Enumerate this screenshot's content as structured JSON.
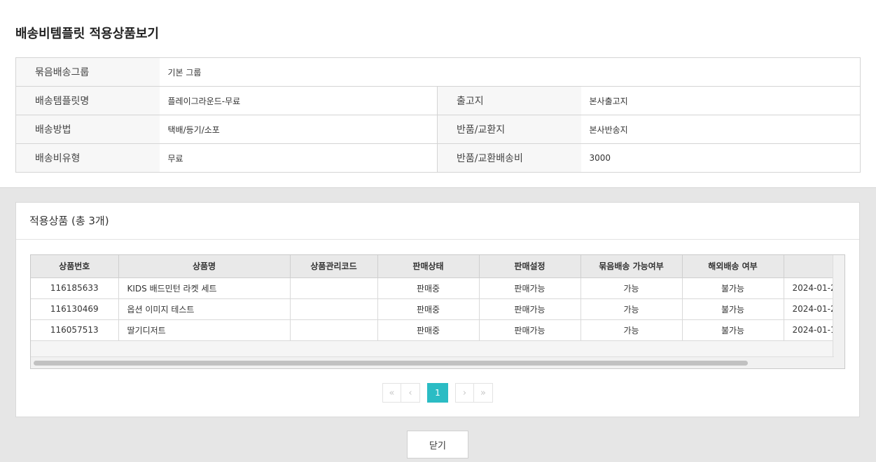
{
  "page_title": "배송비템플릿 적용상품보기",
  "info": {
    "row1": {
      "label": "묶음배송그룹",
      "value": "기본 그룹"
    },
    "row2": {
      "label": "배송템플릿명",
      "value": "플레이그라운드-무료",
      "label2": "출고지",
      "value2": "본사출고지"
    },
    "row3": {
      "label": "배송방법",
      "value": "택배/등기/소포",
      "label2": "반품/교환지",
      "value2": "본사반송지"
    },
    "row4": {
      "label": "배송비유형",
      "value": "무료",
      "label2": "반품/교환배송비",
      "value2": "3000"
    }
  },
  "products": {
    "title": "적용상품 (총 3개)",
    "columns": [
      "상품번호",
      "상품명",
      "상품관리코드",
      "판매상태",
      "판매설정",
      "묶음배송 가능여부",
      "해외배송 여부",
      ""
    ],
    "rows": [
      [
        "116185633",
        "KIDS 배드민턴 라켓 세트",
        "",
        "판매중",
        "판매가능",
        "가능",
        "불가능",
        "2024-01-2"
      ],
      [
        "116130469",
        "옵션 이미지 테스트",
        "",
        "판매중",
        "판매가능",
        "가능",
        "불가능",
        "2024-01-2"
      ],
      [
        "116057513",
        "딸기디저트",
        "",
        "판매중",
        "판매가능",
        "가능",
        "불가능",
        "2024-01-1"
      ]
    ]
  },
  "pagination": {
    "first": "«",
    "prev": "‹",
    "current": "1",
    "next": "›",
    "last": "»"
  },
  "close_label": "닫기",
  "colors": {
    "accent": "#2bbcc4",
    "label_bg": "#f7f7f7",
    "bottom_bg": "#e6e6e6"
  }
}
